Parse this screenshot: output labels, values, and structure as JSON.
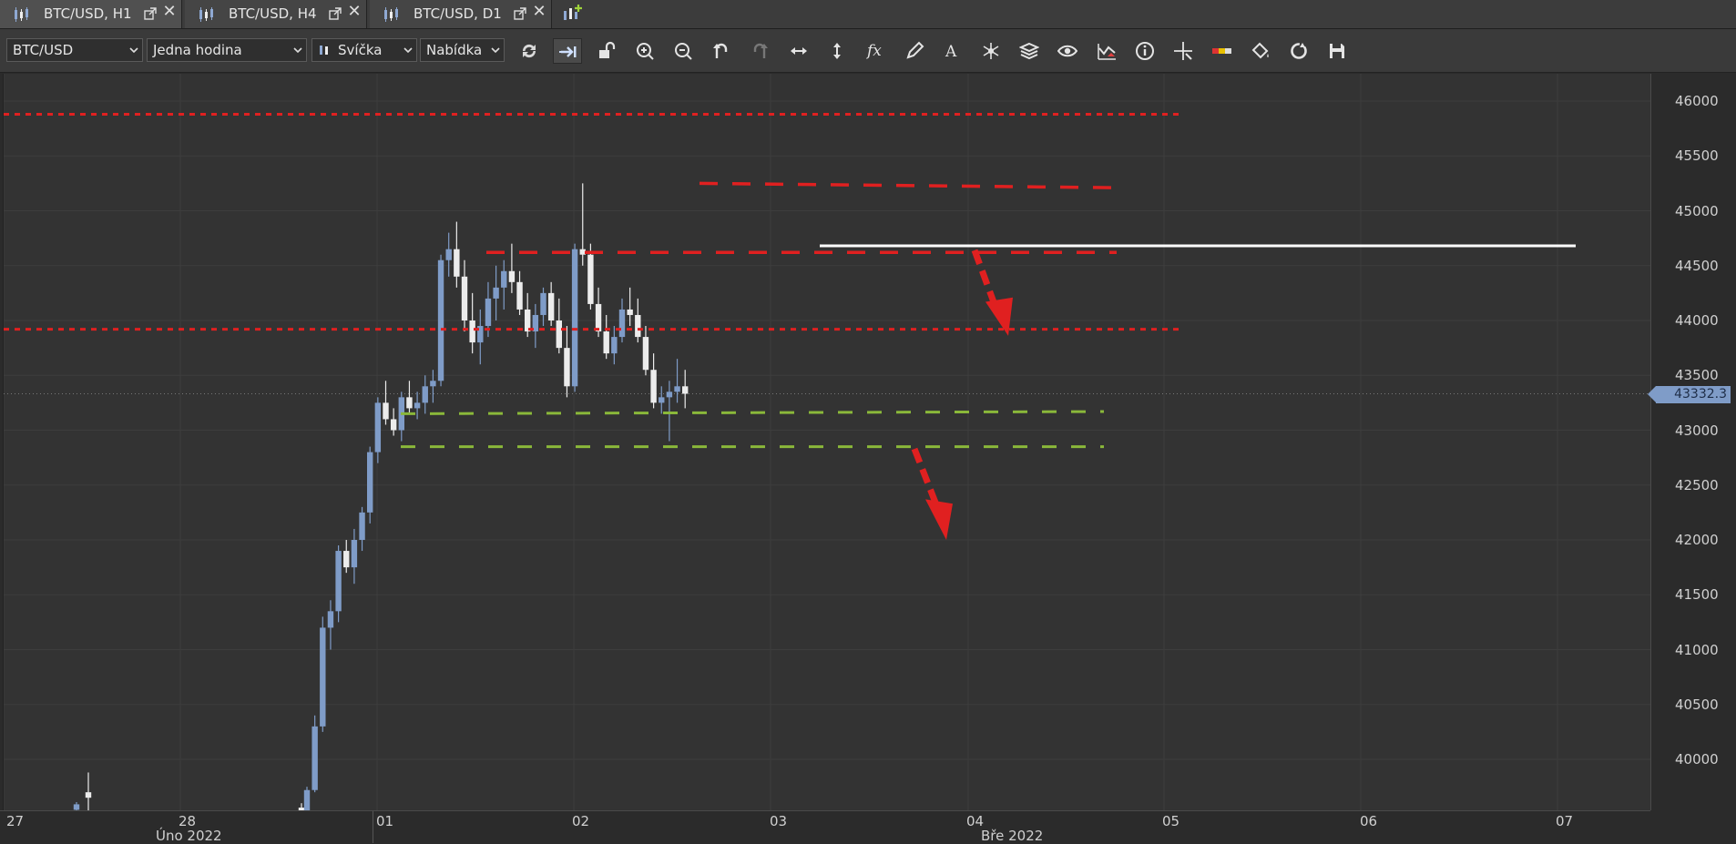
{
  "tabs": [
    {
      "label": "BTC/USD, H1",
      "active": true
    },
    {
      "label": "BTC/USD, H4",
      "active": false
    },
    {
      "label": "BTC/USD, D1",
      "active": false
    }
  ],
  "toolbar": {
    "symbol": "BTC/USD",
    "timeframe": "Jedna hodina",
    "chart_type": "Svíčka",
    "price_side": "Nabídka",
    "buttons": [
      "refresh-icon",
      "scroll-to-end-icon",
      "unlock-icon",
      "zoom-in-icon",
      "zoom-out-icon",
      "undo-icon",
      "redo-icon",
      "fit-horizontal-icon",
      "fit-vertical-icon",
      "indicators-fx-icon",
      "pencil-draw-icon",
      "text-annotation-icon",
      "objects-icon",
      "layers-icon",
      "eye-visibility-icon",
      "wave-alert-icon",
      "info-icon",
      "crosshair-icon",
      "color-bar-icon",
      "paint-bucket-icon",
      "sync-icon",
      "save-icon"
    ]
  },
  "axis": {
    "price_labels": [
      "46000",
      "45500",
      "45000",
      "44500",
      "44000",
      "43500",
      "43000",
      "42500",
      "42000",
      "41500",
      "41000",
      "40500",
      "40000"
    ],
    "day_labels": [
      "27",
      "28",
      "01",
      "02",
      "03",
      "04",
      "05",
      "06",
      "07"
    ],
    "month_labels": [
      "Úno 2022",
      "Bře 2022"
    ],
    "current_price": "43332.3"
  },
  "colors": {
    "bull": "#7f9cc8",
    "bear": "#ececec",
    "resistance": "#e02020",
    "support": "#8ab83a",
    "level": "#ffffff"
  },
  "chart_data": {
    "type": "candlestick",
    "symbol": "BTC/USD",
    "timeframe": "H1",
    "ylim": [
      39500,
      46200
    ],
    "candles": [
      [
        39540,
        39610,
        39480,
        39590
      ],
      [
        39700,
        39880,
        39520,
        39650
      ],
      [
        39560,
        39600,
        39450,
        39520
      ],
      [
        39500,
        39750,
        39450,
        39720
      ],
      [
        39720,
        40400,
        39700,
        40300
      ],
      [
        40300,
        41300,
        40250,
        41200
      ],
      [
        41200,
        41450,
        41000,
        41350
      ],
      [
        41350,
        41950,
        41250,
        41900
      ],
      [
        41900,
        42000,
        41700,
        41750
      ],
      [
        41750,
        42100,
        41600,
        42000
      ],
      [
        42000,
        42300,
        41900,
        42250
      ],
      [
        42250,
        42850,
        42150,
        42800
      ],
      [
        42800,
        43300,
        42700,
        43250
      ],
      [
        43250,
        43450,
        43050,
        43100
      ],
      [
        43100,
        43200,
        42950,
        43000
      ],
      [
        43000,
        43350,
        42900,
        43300
      ],
      [
        43300,
        43450,
        43150,
        43200
      ],
      [
        43200,
        43350,
        43100,
        43250
      ],
      [
        43250,
        43500,
        43150,
        43400
      ],
      [
        43400,
        43550,
        43250,
        43450
      ],
      [
        43450,
        44600,
        43400,
        44550
      ],
      [
        44550,
        44800,
        44400,
        44650
      ],
      [
        44650,
        44900,
        44300,
        44400
      ],
      [
        44400,
        44550,
        43900,
        44000
      ],
      [
        44000,
        44250,
        43700,
        43800
      ],
      [
        43800,
        44100,
        43600,
        43950
      ],
      [
        43950,
        44350,
        43850,
        44200
      ],
      [
        44200,
        44500,
        44000,
        44300
      ],
      [
        44300,
        44550,
        44100,
        44450
      ],
      [
        44450,
        44700,
        44250,
        44350
      ],
      [
        44350,
        44450,
        44050,
        44100
      ],
      [
        44100,
        44250,
        43850,
        43900
      ],
      [
        43900,
        44150,
        43750,
        44050
      ],
      [
        44050,
        44300,
        43950,
        44250
      ],
      [
        44250,
        44350,
        43950,
        44000
      ],
      [
        44000,
        44200,
        43700,
        43750
      ],
      [
        43750,
        43950,
        43300,
        43400
      ],
      [
        43400,
        44700,
        43350,
        44650
      ],
      [
        44650,
        45250,
        44500,
        44600
      ],
      [
        44600,
        44700,
        44100,
        44150
      ],
      [
        44150,
        44300,
        43850,
        43900
      ],
      [
        43900,
        44050,
        43650,
        43700
      ],
      [
        43700,
        43950,
        43600,
        43850
      ],
      [
        43850,
        44200,
        43800,
        44100
      ],
      [
        44100,
        44300,
        43950,
        44050
      ],
      [
        44050,
        44200,
        43800,
        43850
      ],
      [
        43850,
        43950,
        43500,
        43550
      ],
      [
        43550,
        43700,
        43200,
        43250
      ],
      [
        43250,
        43400,
        43150,
        43300
      ],
      [
        43300,
        43450,
        42900,
        43350
      ],
      [
        43350,
        43650,
        43250,
        43400
      ],
      [
        43400,
        43550,
        43200,
        43332
      ]
    ],
    "current_price": 43332.3,
    "annotations": {
      "resistance_lines": [
        45880,
        45250,
        44620,
        43920
      ],
      "support_lines": [
        43150,
        42850
      ],
      "key_level": 44680
    }
  }
}
